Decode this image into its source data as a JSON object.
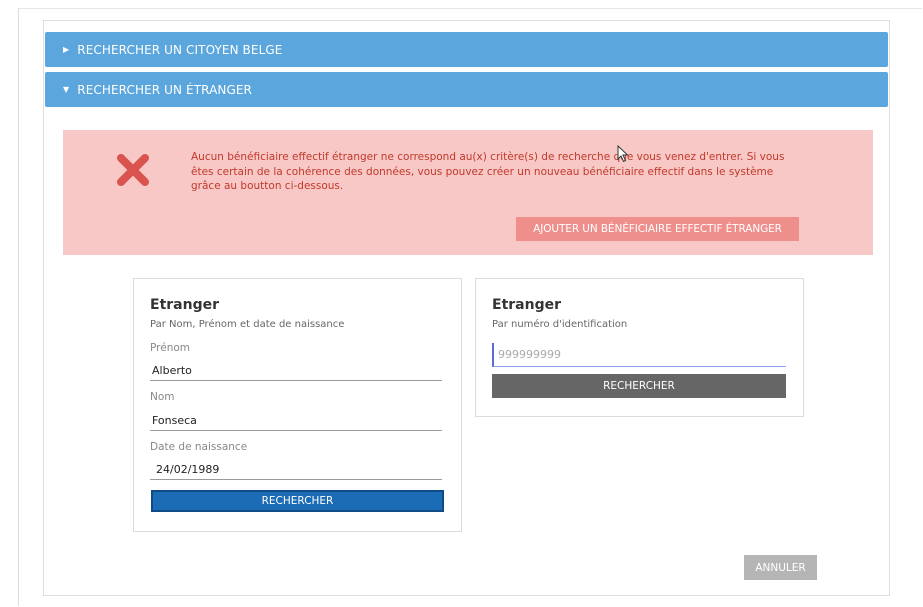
{
  "accordion": {
    "belge_label": "RECHERCHER UN CITOYEN BELGE",
    "etranger_label": "RECHERCHER UN ÉTRANGER"
  },
  "alert": {
    "message": "Aucun bénéficiaire effectif étranger ne correspond au(x) critère(s) de recherche que vous venez d'entrer. Si vous êtes certain de la cohérence des données, vous pouvez créer un nouveau bénéficiaire effectif dans le système grâce au boutton ci-dessous.",
    "add_button_label": "AJOUTER UN BÉNÉFICIAIRE EFFECTIF ÉTRANGER",
    "icon": "close-icon",
    "color": "#d9534f"
  },
  "card_name": {
    "title": "Etranger",
    "subtitle": "Par Nom, Prénom et date de naissance",
    "prenom_label": "Prénom",
    "prenom_value": "Alberto",
    "nom_label": "Nom",
    "nom_value": "Fonseca",
    "dob_label": "Date de naissance",
    "dob_value": "24/02/1989",
    "search_label": "RECHERCHER"
  },
  "card_id": {
    "title": "Etranger",
    "subtitle": "Par numéro d'identification",
    "id_placeholder": "999999999",
    "search_label": "RECHERCHER"
  },
  "footer": {
    "cancel_label": "ANNULER"
  },
  "colors": {
    "accordion": "#5ba6dc",
    "alert_bg": "#f8c8c6",
    "primary_button": "#1b6cb5"
  }
}
